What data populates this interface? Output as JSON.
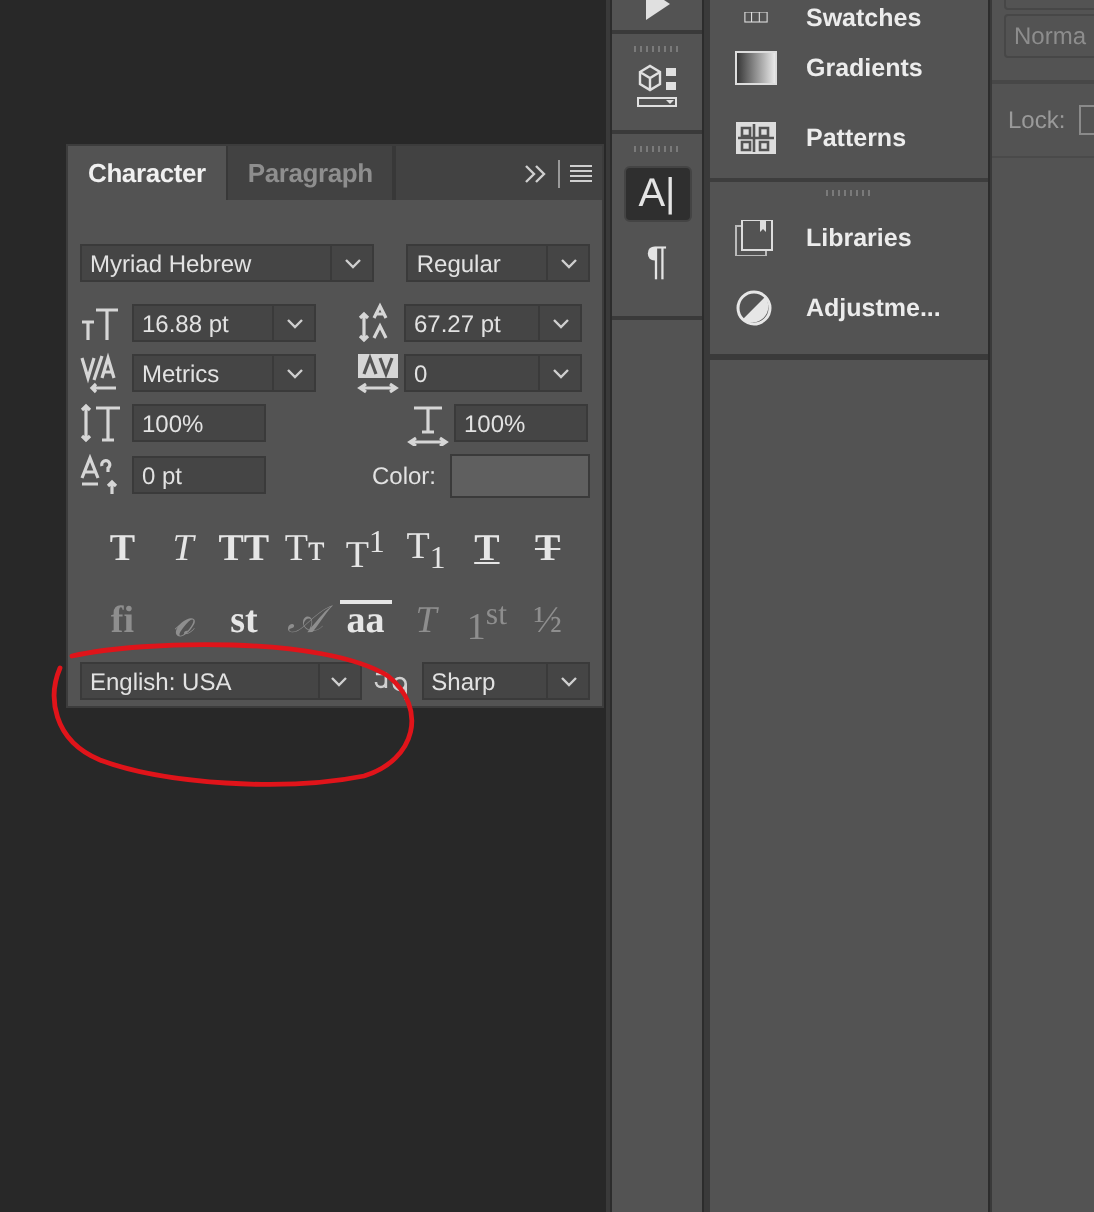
{
  "character_panel": {
    "tabs": [
      {
        "label": "Character",
        "selected": true
      },
      {
        "label": "Paragraph",
        "selected": false
      }
    ],
    "font_family": "Myriad Hebrew",
    "font_style": "Regular",
    "font_size": "16.88 pt",
    "leading": "67.27 pt",
    "kerning": "Metrics",
    "tracking": "0",
    "vertical_scale": "100%",
    "horizontal_scale": "100%",
    "baseline_shift": "0 pt",
    "color_label": "Color:",
    "style_buttons": [
      {
        "label": "T",
        "kind": "bold"
      },
      {
        "label": "T",
        "kind": "italic"
      },
      {
        "label": "TT",
        "kind": "caps"
      },
      {
        "label": "Tᴛ",
        "kind": "smallcaps"
      },
      {
        "label": "T$^{1}$",
        "kind": "superscript"
      },
      {
        "label": "T$_{1}$",
        "kind": "subscript"
      },
      {
        "label": "T",
        "kind": "underline"
      },
      {
        "label": "T",
        "kind": "strikethrough"
      }
    ],
    "opentype_buttons": [
      {
        "label": "fi",
        "kind": "ligature",
        "disabled": true
      },
      {
        "label": "ℴ",
        "kind": "swash",
        "disabled": true
      },
      {
        "label": "st",
        "kind": "ligature",
        "disabled": false
      },
      {
        "label": "𝒜",
        "kind": "script",
        "disabled": true
      },
      {
        "label": "aa",
        "kind": "stylistic",
        "disabled": false
      },
      {
        "label": "T",
        "kind": "titling",
        "disabled": true
      },
      {
        "label": "1$^{st}$",
        "kind": "ordinal",
        "disabled": true
      },
      {
        "label": "½",
        "kind": "fraction",
        "disabled": true
      }
    ],
    "language": "English: USA",
    "antialiasing": "Sharp"
  },
  "dock_tools": [
    {
      "label": "A|",
      "selected": true
    },
    {
      "label": "¶",
      "selected": false
    }
  ],
  "panels": [
    {
      "label": "Swatches",
      "kind": "swatches"
    },
    {
      "label": "Gradients",
      "kind": "gradients"
    },
    {
      "label": "Patterns",
      "kind": "patterns"
    },
    {
      "label": "Libraries",
      "kind": "libraries"
    },
    {
      "label": "Adjustme...",
      "kind": "adjustments"
    }
  ],
  "layers": {
    "blend_mode": "Norma",
    "lock_label": "Lock:"
  }
}
